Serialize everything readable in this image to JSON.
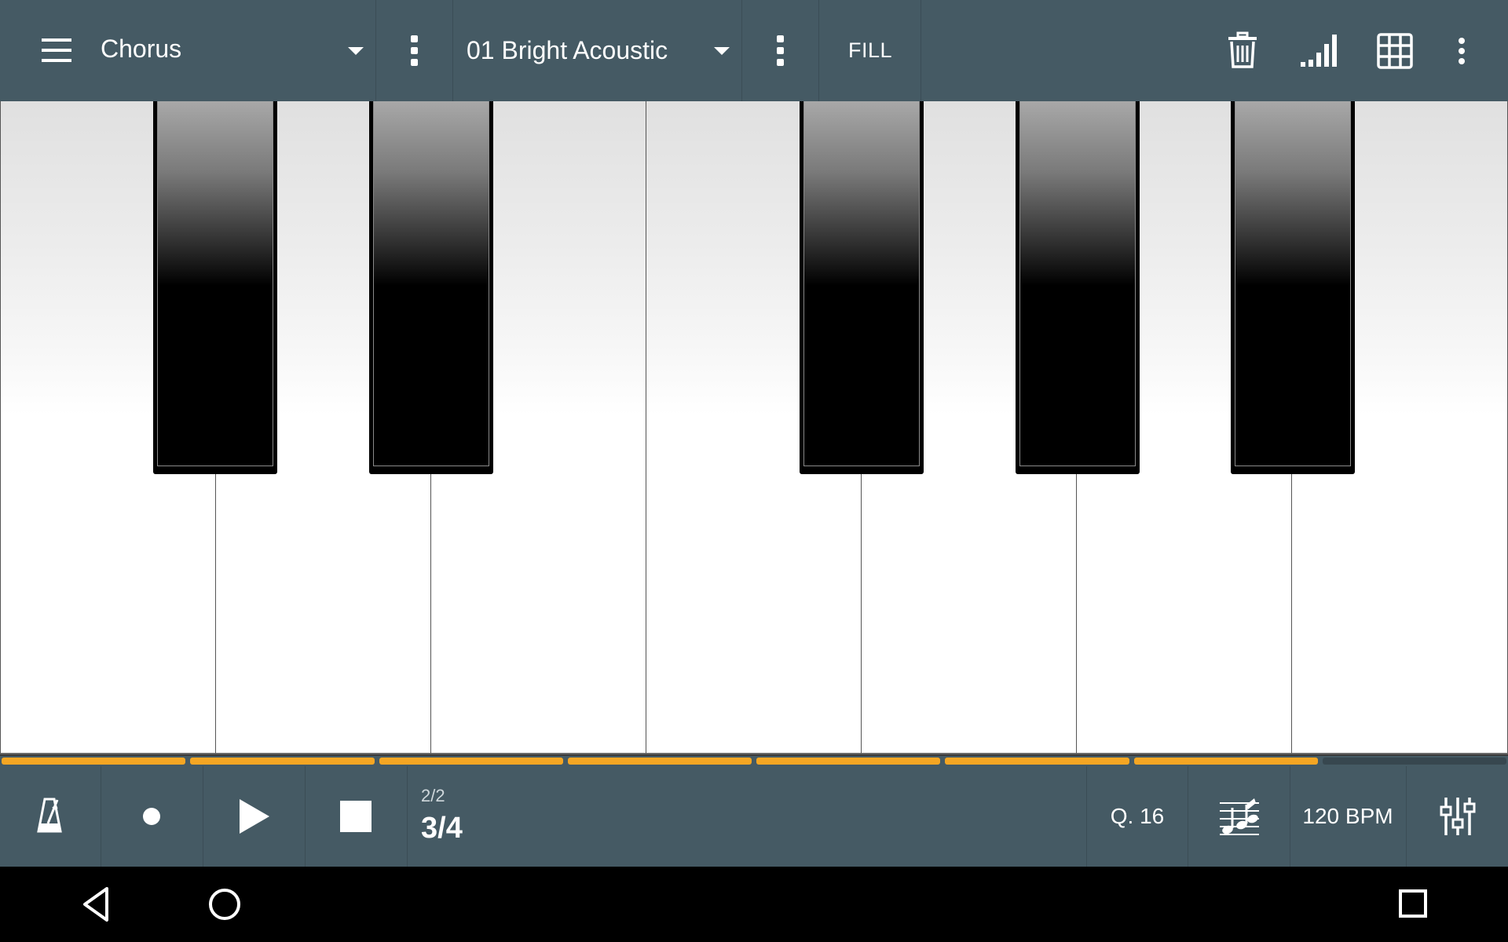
{
  "app": {
    "accent_color": "#f5a623",
    "toolbar_color": "#455a64"
  },
  "toolbar": {
    "section_name": "Chorus",
    "instrument_name": "01 Bright Acoustic",
    "fill_label": "FILL",
    "icons": [
      "menu-icon",
      "more-vert-icon",
      "more-vert-icon",
      "trash-icon",
      "velocity-bars-icon",
      "grid-icon",
      "more-vert-icon"
    ]
  },
  "keyboard": {
    "white_keys": 7,
    "black_keys": 5
  },
  "progress": {
    "segments_total": 8,
    "segments_filled": 7
  },
  "transport": {
    "metronome_icon": "metronome-icon",
    "record_icon": "record-icon",
    "play_icon": "play-icon",
    "stop_icon": "stop-icon",
    "measure_of_total": "2/2",
    "time_signature": "3/4",
    "quantize_label": "Q. 16",
    "notation_icon": "music-notes-icon",
    "tempo_label": "120 BPM",
    "mixer_icon": "mixer-sliders-icon"
  },
  "system_nav": {
    "icons": [
      "back-icon",
      "home-icon",
      "recents-icon"
    ]
  }
}
